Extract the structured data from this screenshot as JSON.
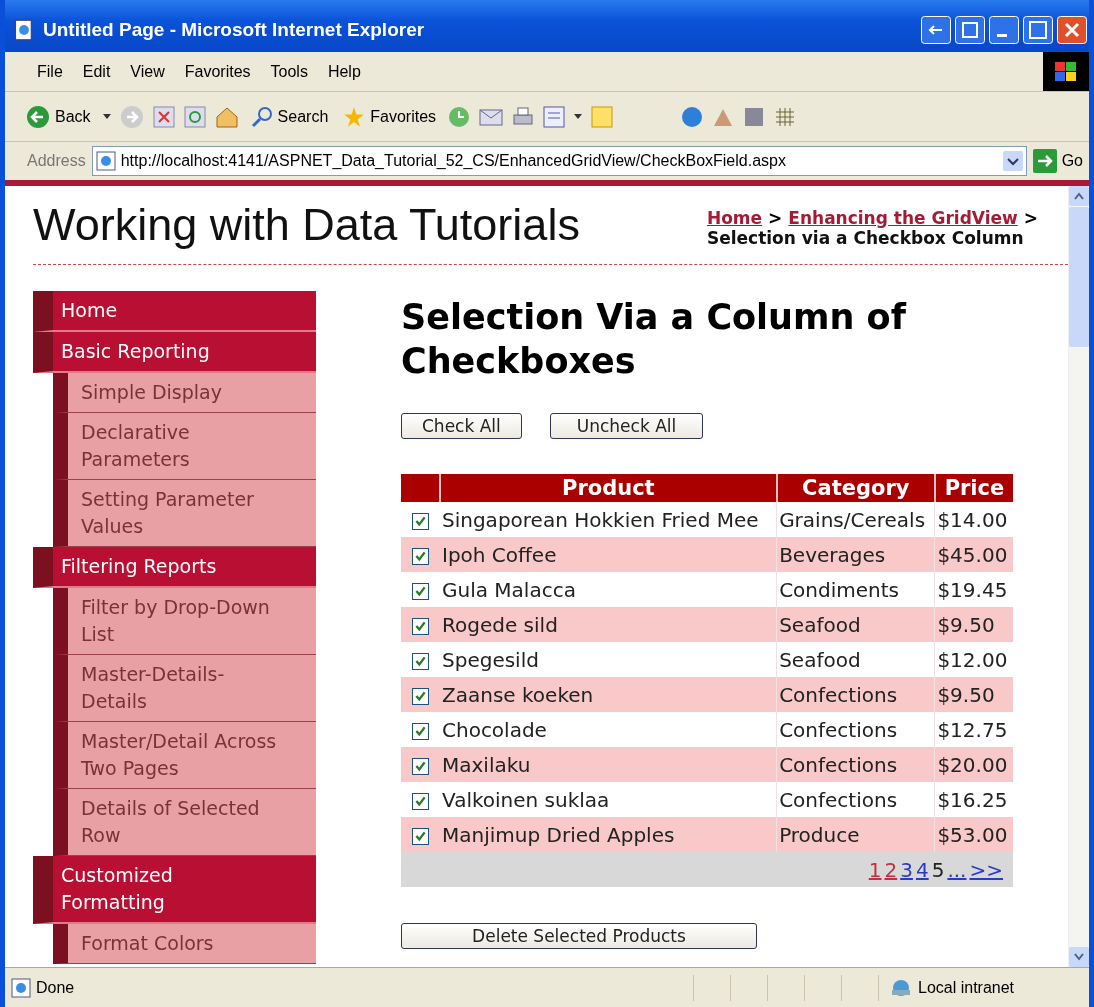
{
  "window": {
    "title": "Untitled Page - Microsoft Internet Explorer"
  },
  "menu": [
    "File",
    "Edit",
    "View",
    "Favorites",
    "Tools",
    "Help"
  ],
  "toolbar": {
    "back": "Back",
    "search": "Search",
    "favorites": "Favorites"
  },
  "address_bar": {
    "label": "Address",
    "url": "http://localhost:4141/ASPNET_Data_Tutorial_52_CS/EnhancedGridView/CheckBoxField.aspx",
    "go": "Go"
  },
  "page": {
    "site_title": "Working with Data Tutorials",
    "breadcrumb": {
      "links": [
        "Home",
        "Enhancing the GridView"
      ],
      "separator": ">",
      "current": "Selection via a Checkbox Column"
    },
    "sidebar": {
      "items": [
        {
          "label": "Home"
        },
        {
          "label": "Basic Reporting",
          "children": [
            {
              "label": "Simple Display"
            },
            {
              "label": "Declarative Parameters"
            },
            {
              "label": "Setting Parameter Values"
            }
          ]
        },
        {
          "label": "Filtering Reports",
          "children": [
            {
              "label": "Filter by Drop-Down List"
            },
            {
              "label": "Master-Details-Details"
            },
            {
              "label": "Master/Detail Across Two Pages"
            },
            {
              "label": "Details of Selected Row"
            }
          ]
        },
        {
          "label": "Customized Formatting",
          "children": [
            {
              "label": "Format Colors"
            }
          ]
        }
      ]
    },
    "heading": "Selection Via a Column of Checkboxes",
    "buttons": [
      "Check All",
      "Uncheck All"
    ],
    "table": {
      "columns": [
        "Product",
        "Category",
        "Price"
      ],
      "rows": [
        {
          "checked": true,
          "product": "Singaporean Hokkien Fried Mee",
          "category": "Grains/Cereals",
          "price": "$14.00"
        },
        {
          "checked": true,
          "product": "Ipoh Coffee",
          "category": "Beverages",
          "price": "$45.00"
        },
        {
          "checked": true,
          "product": "Gula Malacca",
          "category": "Condiments",
          "price": "$19.45"
        },
        {
          "checked": true,
          "product": "Rogede sild",
          "category": "Seafood",
          "price": "$9.50"
        },
        {
          "checked": true,
          "product": "Spegesild",
          "category": "Seafood",
          "price": "$12.00"
        },
        {
          "checked": true,
          "product": "Zaanse koeken",
          "category": "Confections",
          "price": "$9.50"
        },
        {
          "checked": true,
          "product": "Chocolade",
          "category": "Confections",
          "price": "$12.75"
        },
        {
          "checked": true,
          "product": "Maxilaku",
          "category": "Confections",
          "price": "$20.00"
        },
        {
          "checked": true,
          "product": "Valkoinen suklaa",
          "category": "Confections",
          "price": "$16.25"
        },
        {
          "checked": true,
          "product": "Manjimup Dried Apples",
          "category": "Produce",
          "price": "$53.00"
        }
      ],
      "pager": [
        {
          "label": "1",
          "selected": false,
          "visited": true
        },
        {
          "label": "2",
          "selected": false,
          "visited": true
        },
        {
          "label": "3",
          "selected": false,
          "visited": false
        },
        {
          "label": "4",
          "selected": false,
          "visited": false
        },
        {
          "label": "5",
          "selected": true,
          "visited": false
        },
        {
          "label": "...",
          "selected": false,
          "visited": false
        },
        {
          "label": ">>",
          "selected": false,
          "visited": false
        }
      ]
    },
    "delete_button": "Delete Selected Products"
  },
  "status_bar": {
    "text": "Done",
    "zone": "Local intranet"
  }
}
